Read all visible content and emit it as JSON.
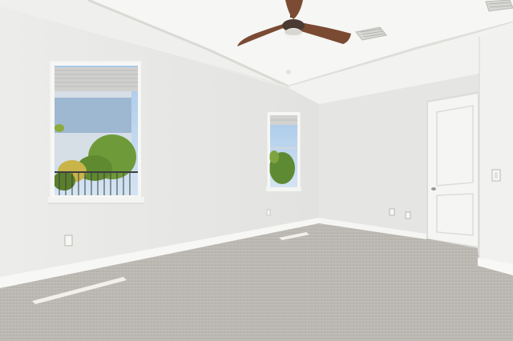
{
  "scene": {
    "description_free": true,
    "colors": {
      "ceiling": "#f1f1ef",
      "tray_ceiling": "#f7f7f5",
      "left_wall": "#ececea",
      "back_wall": "#e6e6e4",
      "right_wall": "#f0f0ee",
      "carpet": "#bdbab5",
      "baseboard": "#f6f6f4",
      "door": "#f4f4f2",
      "fan_blade": "#7a4a33",
      "sky": "#b6d2ee",
      "palm": "#6f9a3a",
      "sunlight": "#f7f5ee"
    },
    "objects": {
      "ceiling_fan": "ceiling-fan",
      "vents": 2,
      "windows": 2,
      "doors": 1,
      "outlets": 3,
      "light_switch": 1
    }
  }
}
